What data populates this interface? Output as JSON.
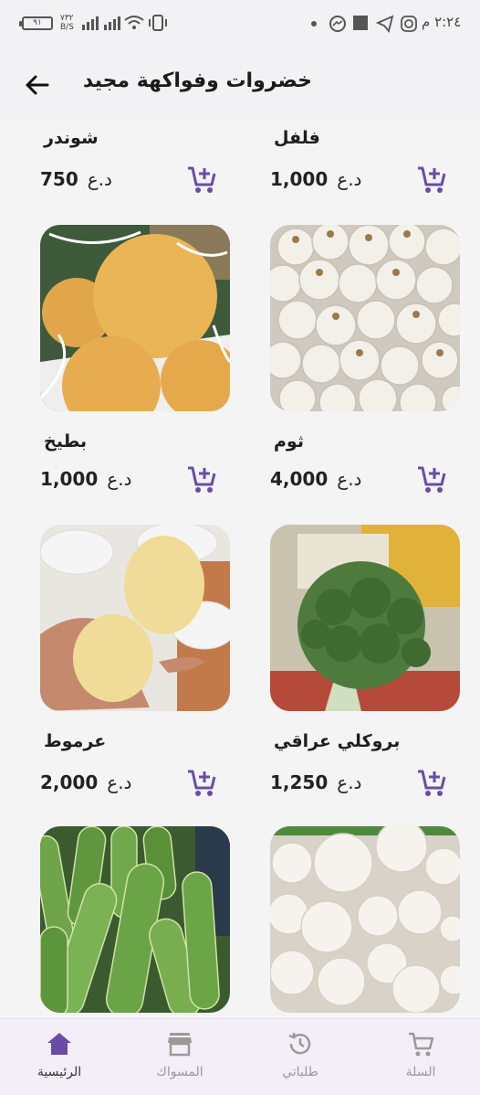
{
  "status_bar": {
    "time": "٢:٢٤ م",
    "battery": "٩١",
    "speed": "٧٣٢ B/S"
  },
  "header": {
    "title": "خضروات وفواكهة مجيد"
  },
  "products": [
    {
      "name": "فلفل",
      "price": "1,000",
      "currency": "د.ع",
      "image": "pepper"
    },
    {
      "name": "شوندر",
      "price": "750",
      "currency": "د.ع",
      "image": "beetroot"
    },
    {
      "name": "ثوم",
      "price": "4,000",
      "currency": "د.ع",
      "image": "garlic-photo"
    },
    {
      "name": "بطيخ",
      "price": "1,000",
      "currency": "د.ع",
      "image": "melon-photo"
    },
    {
      "name": "بروكلي عراقي",
      "price": "1,250",
      "currency": "د.ع",
      "image": "broccoli-photo"
    },
    {
      "name": "عرموط",
      "price": "2,000",
      "currency": "د.ع",
      "image": "pear-photo"
    },
    {
      "name": "",
      "price": "",
      "currency": "",
      "image": "mushroom-photo"
    },
    {
      "name": "",
      "price": "",
      "currency": "",
      "image": "zucchini-photo"
    }
  ],
  "bottom_nav": {
    "items": [
      {
        "label": "السلة",
        "icon": "cart-icon"
      },
      {
        "label": "طلباتي",
        "icon": "history-icon"
      },
      {
        "label": "المسواك",
        "icon": "store-icon"
      },
      {
        "label": "الرئيسية",
        "icon": "home-icon",
        "active": true
      }
    ]
  },
  "colors": {
    "accent": "#6a4ca8",
    "background": "#f4f4f4",
    "nav_background": "#f3eef7"
  }
}
